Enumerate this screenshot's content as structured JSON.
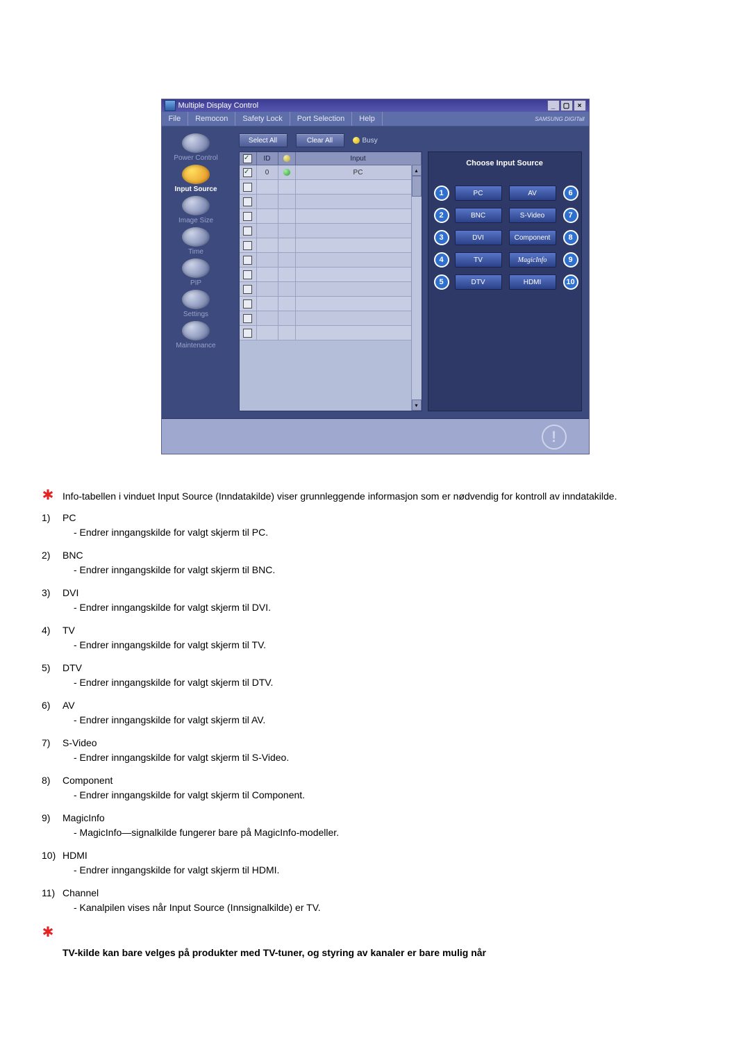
{
  "app": {
    "title": "Multiple Display Control",
    "brand": "SAMSUNG DIGITall",
    "menu": [
      "File",
      "Remocon",
      "Safety Lock",
      "Port Selection",
      "Help"
    ],
    "sidebar": [
      {
        "label": "Power Control",
        "active": false
      },
      {
        "label": "Input Source",
        "active": true
      },
      {
        "label": "Image Size",
        "active": false
      },
      {
        "label": "Time",
        "active": false
      },
      {
        "label": "PIP",
        "active": false
      },
      {
        "label": "Settings",
        "active": false
      },
      {
        "label": "Maintenance",
        "active": false
      }
    ],
    "toolbar": {
      "select_all": "Select All",
      "clear_all": "Clear All",
      "busy": "Busy"
    },
    "table": {
      "headers": {
        "c2": "ID",
        "c4": "Input"
      },
      "rows": [
        {
          "checked": true,
          "id": "0",
          "status": "on",
          "input": "PC"
        },
        {
          "checked": false,
          "id": "",
          "status": "",
          "input": ""
        },
        {
          "checked": false,
          "id": "",
          "status": "",
          "input": ""
        },
        {
          "checked": false,
          "id": "",
          "status": "",
          "input": ""
        },
        {
          "checked": false,
          "id": "",
          "status": "",
          "input": ""
        },
        {
          "checked": false,
          "id": "",
          "status": "",
          "input": ""
        },
        {
          "checked": false,
          "id": "",
          "status": "",
          "input": ""
        },
        {
          "checked": false,
          "id": "",
          "status": "",
          "input": ""
        },
        {
          "checked": false,
          "id": "",
          "status": "",
          "input": ""
        },
        {
          "checked": false,
          "id": "",
          "status": "",
          "input": ""
        },
        {
          "checked": false,
          "id": "",
          "status": "",
          "input": ""
        },
        {
          "checked": false,
          "id": "",
          "status": "",
          "input": ""
        }
      ]
    },
    "right": {
      "title": "Choose Input Source",
      "left_col": [
        {
          "num": "1",
          "label": "PC"
        },
        {
          "num": "2",
          "label": "BNC"
        },
        {
          "num": "3",
          "label": "DVI"
        },
        {
          "num": "4",
          "label": "TV"
        },
        {
          "num": "5",
          "label": "DTV"
        }
      ],
      "right_col": [
        {
          "num": "6",
          "label": "AV"
        },
        {
          "num": "7",
          "label": "S-Video"
        },
        {
          "num": "8",
          "label": "Component"
        },
        {
          "num": "9",
          "label": "MagicInfo"
        },
        {
          "num": "10",
          "label": "HDMI"
        }
      ]
    }
  },
  "desc": {
    "intro": "Info-tabellen i vinduet Input Source (Inndatakilde) viser grunnleggende informasjon som er nødvendig for kontroll av inndatakilde.",
    "items": [
      {
        "n": "1)",
        "t": "PC",
        "s": "- Endrer inngangskilde for valgt skjerm til PC."
      },
      {
        "n": "2)",
        "t": "BNC",
        "s": "- Endrer inngangskilde for valgt skjerm til BNC."
      },
      {
        "n": "3)",
        "t": "DVI",
        "s": "- Endrer inngangskilde for valgt skjerm til DVI."
      },
      {
        "n": "4)",
        "t": "TV",
        "s": "- Endrer inngangskilde for valgt skjerm til TV."
      },
      {
        "n": "5)",
        "t": "DTV",
        "s": "- Endrer inngangskilde for valgt skjerm til DTV."
      },
      {
        "n": "6)",
        "t": "AV",
        "s": "- Endrer inngangskilde for valgt skjerm til AV."
      },
      {
        "n": "7)",
        "t": "S-Video",
        "s": "- Endrer inngangskilde for valgt skjerm til S-Video."
      },
      {
        "n": "8)",
        "t": "Component",
        "s": "- Endrer inngangskilde for valgt skjerm til Component."
      },
      {
        "n": "9)",
        "t": "MagicInfo",
        "s": "- MagicInfo—signalkilde fungerer bare på MagicInfo-modeller."
      },
      {
        "n": "10)",
        "t": "HDMI",
        "s": "- Endrer inngangskilde for valgt skjerm til HDMI."
      },
      {
        "n": "11)",
        "t": "Channel",
        "s": "- Kanalpilen vises når Input Source (Innsignalkilde) er TV."
      }
    ],
    "bottom": "TV-kilde kan bare velges på produkter med TV-tuner, og styring av kanaler er bare mulig når"
  }
}
